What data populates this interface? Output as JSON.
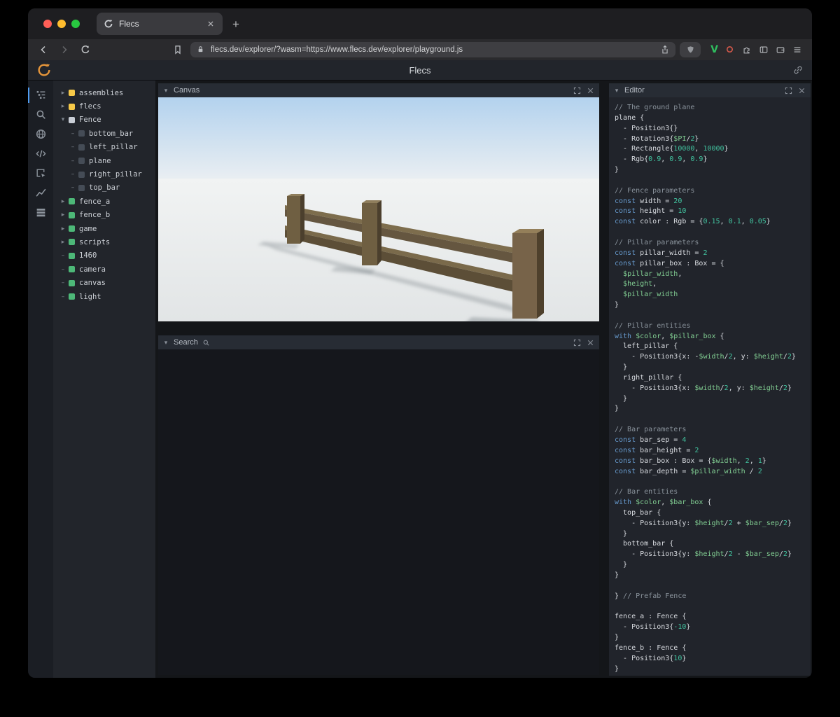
{
  "browser": {
    "tab_title": "Flecs",
    "new_tab_glyph": "+",
    "url": "flecs.dev/explorer/?wasm=https://www.flecs.dev/explorer/playground.js"
  },
  "app": {
    "title": "Flecs"
  },
  "toolbar": {
    "icons": [
      "tree",
      "search",
      "world",
      "code",
      "inspect",
      "chart",
      "stats"
    ]
  },
  "panels": {
    "canvas": {
      "title": "Canvas"
    },
    "search": {
      "title": "Search"
    },
    "editor": {
      "title": "Editor"
    }
  },
  "tree": {
    "items": [
      {
        "label": "assemblies",
        "dot": "yellow",
        "depth": 0,
        "exp": "collapsed"
      },
      {
        "label": "flecs",
        "dot": "yellow",
        "depth": 0,
        "exp": "collapsed"
      },
      {
        "label": "Fence",
        "dot": "light",
        "depth": 0,
        "exp": "expanded"
      },
      {
        "label": "bottom_bar",
        "dot": "dark",
        "depth": 1,
        "exp": "leaf"
      },
      {
        "label": "left_pillar",
        "dot": "dark",
        "depth": 1,
        "exp": "leaf"
      },
      {
        "label": "plane",
        "dot": "dark",
        "depth": 1,
        "exp": "leaf"
      },
      {
        "label": "right_pillar",
        "dot": "dark",
        "depth": 1,
        "exp": "leaf"
      },
      {
        "label": "top_bar",
        "dot": "dark",
        "depth": 1,
        "exp": "leaf"
      },
      {
        "label": "fence_a",
        "dot": "green",
        "depth": 0,
        "exp": "collapsed"
      },
      {
        "label": "fence_b",
        "dot": "green",
        "depth": 0,
        "exp": "collapsed"
      },
      {
        "label": "game",
        "dot": "green",
        "depth": 0,
        "exp": "collapsed"
      },
      {
        "label": "scripts",
        "dot": "green",
        "depth": 0,
        "exp": "collapsed"
      },
      {
        "label": "1460",
        "dot": "green",
        "depth": 0,
        "exp": "leaf"
      },
      {
        "label": "camera",
        "dot": "green",
        "depth": 0,
        "exp": "leaf"
      },
      {
        "label": "canvas",
        "dot": "green",
        "depth": 0,
        "exp": "leaf"
      },
      {
        "label": "light",
        "dot": "green",
        "depth": 0,
        "exp": "leaf"
      }
    ]
  },
  "editor": {
    "lines": [
      [
        [
          "c",
          "// The ground plane"
        ]
      ],
      [
        [
          "p",
          "plane {"
        ]
      ],
      [
        [
          "p",
          "  - Position3{}"
        ]
      ],
      [
        [
          "p",
          "  - Rotation3{"
        ],
        [
          "v",
          "$PI"
        ],
        [
          "p",
          "/"
        ],
        [
          "n",
          "2"
        ],
        [
          "p",
          "}"
        ]
      ],
      [
        [
          "p",
          "  - Rectangle{"
        ],
        [
          "n",
          "10000"
        ],
        [
          "p",
          ", "
        ],
        [
          "n",
          "10000"
        ],
        [
          "p",
          "}"
        ]
      ],
      [
        [
          "p",
          "  - Rgb{"
        ],
        [
          "n",
          "0.9"
        ],
        [
          "p",
          ", "
        ],
        [
          "n",
          "0.9"
        ],
        [
          "p",
          ", "
        ],
        [
          "n",
          "0.9"
        ],
        [
          "p",
          "}"
        ]
      ],
      [
        [
          "p",
          "}"
        ]
      ],
      [],
      [
        [
          "c",
          "// Fence parameters"
        ]
      ],
      [
        [
          "k",
          "const "
        ],
        [
          "p",
          "width = "
        ],
        [
          "n",
          "20"
        ]
      ],
      [
        [
          "k",
          "const "
        ],
        [
          "p",
          "height = "
        ],
        [
          "n",
          "10"
        ]
      ],
      [
        [
          "k",
          "const "
        ],
        [
          "p",
          "color : Rgb = {"
        ],
        [
          "n",
          "0.15"
        ],
        [
          "p",
          ", "
        ],
        [
          "n",
          "0.1"
        ],
        [
          "p",
          ", "
        ],
        [
          "n",
          "0.05"
        ],
        [
          "p",
          "}"
        ]
      ],
      [],
      [
        [
          "c",
          "// Pillar parameters"
        ]
      ],
      [
        [
          "k",
          "const "
        ],
        [
          "p",
          "pillar_width = "
        ],
        [
          "n",
          "2"
        ]
      ],
      [
        [
          "k",
          "const "
        ],
        [
          "p",
          "pillar_box : Box = {"
        ]
      ],
      [
        [
          "p",
          "  "
        ],
        [
          "v",
          "$pillar_width"
        ],
        [
          "p",
          ","
        ]
      ],
      [
        [
          "p",
          "  "
        ],
        [
          "v",
          "$height"
        ],
        [
          "p",
          ","
        ]
      ],
      [
        [
          "p",
          "  "
        ],
        [
          "v",
          "$pillar_width"
        ]
      ],
      [
        [
          "p",
          "}"
        ]
      ],
      [],
      [
        [
          "c",
          "// Pillar entities"
        ]
      ],
      [
        [
          "k",
          "with "
        ],
        [
          "v",
          "$color"
        ],
        [
          "p",
          ", "
        ],
        [
          "v",
          "$pillar_box"
        ],
        [
          "p",
          " {"
        ]
      ],
      [
        [
          "p",
          "  left_pillar {"
        ]
      ],
      [
        [
          "p",
          "    - Position3{x: -"
        ],
        [
          "v",
          "$width"
        ],
        [
          "p",
          "/"
        ],
        [
          "n",
          "2"
        ],
        [
          "p",
          ", y: "
        ],
        [
          "v",
          "$height"
        ],
        [
          "p",
          "/"
        ],
        [
          "n",
          "2"
        ],
        [
          "p",
          "}"
        ]
      ],
      [
        [
          "p",
          "  }"
        ]
      ],
      [
        [
          "p",
          "  right_pillar {"
        ]
      ],
      [
        [
          "p",
          "    - Position3{x: "
        ],
        [
          "v",
          "$width"
        ],
        [
          "p",
          "/"
        ],
        [
          "n",
          "2"
        ],
        [
          "p",
          ", y: "
        ],
        [
          "v",
          "$height"
        ],
        [
          "p",
          "/"
        ],
        [
          "n",
          "2"
        ],
        [
          "p",
          "}"
        ]
      ],
      [
        [
          "p",
          "  }"
        ]
      ],
      [
        [
          "p",
          "}"
        ]
      ],
      [],
      [
        [
          "c",
          "// Bar parameters"
        ]
      ],
      [
        [
          "k",
          "const "
        ],
        [
          "p",
          "bar_sep = "
        ],
        [
          "n",
          "4"
        ]
      ],
      [
        [
          "k",
          "const "
        ],
        [
          "p",
          "bar_height = "
        ],
        [
          "n",
          "2"
        ]
      ],
      [
        [
          "k",
          "const "
        ],
        [
          "p",
          "bar_box : Box = {"
        ],
        [
          "v",
          "$width"
        ],
        [
          "p",
          ", "
        ],
        [
          "n",
          "2"
        ],
        [
          "p",
          ", "
        ],
        [
          "n",
          "1"
        ],
        [
          "p",
          "}"
        ]
      ],
      [
        [
          "k",
          "const "
        ],
        [
          "p",
          "bar_depth = "
        ],
        [
          "v",
          "$pillar_width"
        ],
        [
          "p",
          " / "
        ],
        [
          "n",
          "2"
        ]
      ],
      [],
      [
        [
          "c",
          "// Bar entities"
        ]
      ],
      [
        [
          "k",
          "with "
        ],
        [
          "v",
          "$color"
        ],
        [
          "p",
          ", "
        ],
        [
          "v",
          "$bar_box"
        ],
        [
          "p",
          " {"
        ]
      ],
      [
        [
          "p",
          "  top_bar {"
        ]
      ],
      [
        [
          "p",
          "    - Position3{y: "
        ],
        [
          "v",
          "$height"
        ],
        [
          "p",
          "/"
        ],
        [
          "n",
          "2"
        ],
        [
          "p",
          " + "
        ],
        [
          "v",
          "$bar_sep"
        ],
        [
          "p",
          "/"
        ],
        [
          "n",
          "2"
        ],
        [
          "p",
          "}"
        ]
      ],
      [
        [
          "p",
          "  }"
        ]
      ],
      [
        [
          "p",
          "  bottom_bar {"
        ]
      ],
      [
        [
          "p",
          "    - Position3{y: "
        ],
        [
          "v",
          "$height"
        ],
        [
          "p",
          "/"
        ],
        [
          "n",
          "2"
        ],
        [
          "p",
          " - "
        ],
        [
          "v",
          "$bar_sep"
        ],
        [
          "p",
          "/"
        ],
        [
          "n",
          "2"
        ],
        [
          "p",
          "}"
        ]
      ],
      [
        [
          "p",
          "  }"
        ]
      ],
      [
        [
          "p",
          "}"
        ]
      ],
      [],
      [
        [
          "p",
          "} "
        ],
        [
          "c",
          "// Prefab Fence"
        ]
      ],
      [],
      [
        [
          "p",
          "fence_a : Fence {"
        ]
      ],
      [
        [
          "p",
          "  - Position3{"
        ],
        [
          "n",
          "-10"
        ],
        [
          "p",
          "}"
        ]
      ],
      [
        [
          "p",
          "}"
        ]
      ],
      [
        [
          "p",
          "fence_b : Fence {"
        ]
      ],
      [
        [
          "p",
          "  - Position3{"
        ],
        [
          "n",
          "10"
        ],
        [
          "p",
          "}"
        ]
      ],
      [
        [
          "p",
          "}"
        ]
      ]
    ]
  },
  "colors": {
    "accent_blue": "#4f9cf0",
    "entity_yellow": "#f7c948",
    "entity_green": "#4db878",
    "syntax_keyword": "#6699cc",
    "syntax_variable": "#82cf93",
    "syntax_number": "#42c4a0",
    "syntax_comment": "#8a939c",
    "logo_orange": "#e5953a",
    "traffic_red": "#ff5f57",
    "traffic_yellow": "#febc2e",
    "traffic_green": "#28c840"
  }
}
